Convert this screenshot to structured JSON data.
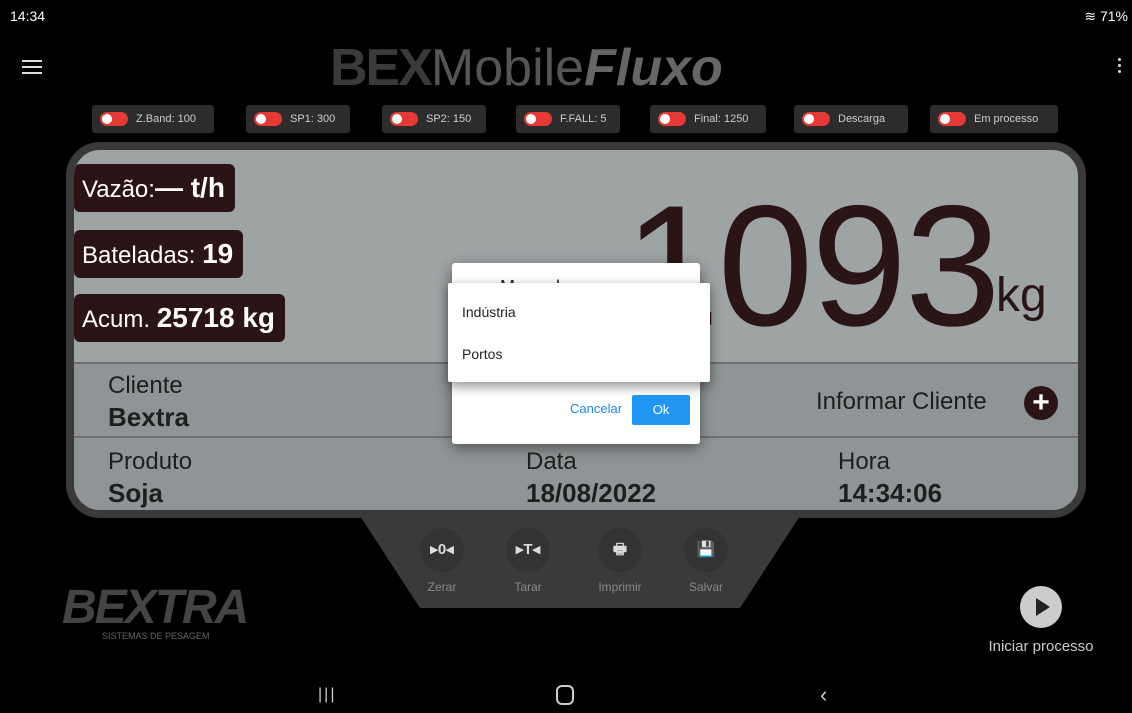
{
  "status_bar": {
    "time": "14:34",
    "battery": "71%"
  },
  "app": {
    "title_bex": "BEX",
    "title_mobile": "Mobile",
    "title_fluxo": "Fluxo"
  },
  "toggles": [
    "Z.Band: 100",
    "SP1: 300",
    "SP2: 150",
    "F.FALL: 5",
    "Final: 1250",
    "Descarga",
    "Em processo"
  ],
  "stats": {
    "vazao_label": "Vazão:",
    "vazao_value": "— t/h",
    "bateladas_label": "Bateladas:",
    "bateladas_value": "19",
    "acum_label": "Acum.",
    "acum_value": "25718 kg"
  },
  "weight": {
    "value": "1093",
    "unit": "kg"
  },
  "cliente": {
    "label": "Cliente",
    "value": "Bextra",
    "action": "Informar Cliente"
  },
  "produto": {
    "label": "Produto",
    "value": "Soja"
  },
  "data": {
    "label": "Data",
    "value": "18/08/2022"
  },
  "hora": {
    "label": "Hora",
    "value": "14:34:06"
  },
  "actions": [
    {
      "icon": "▸0◂",
      "label": "Zerar"
    },
    {
      "icon": "▸T◂",
      "label": "Tarar"
    },
    {
      "icon": "🖶",
      "label": "Imprimir"
    },
    {
      "icon": "💾",
      "label": "Salvar"
    }
  ],
  "brand": {
    "name": "BEXTRA",
    "subtitle": "SISTEMAS DE PESAGEM"
  },
  "start": {
    "label": "Iniciar processo"
  },
  "dialog": {
    "title": "Mercado",
    "cancel_label": "Cancelar",
    "ok_label": "Ok",
    "options": [
      "Indústria",
      "Portos"
    ]
  },
  "colors": {
    "accent": "#2196f3",
    "toggle_off": "#e53935",
    "panel": "#9ea3a4",
    "dark_chip": "#2a1416"
  }
}
